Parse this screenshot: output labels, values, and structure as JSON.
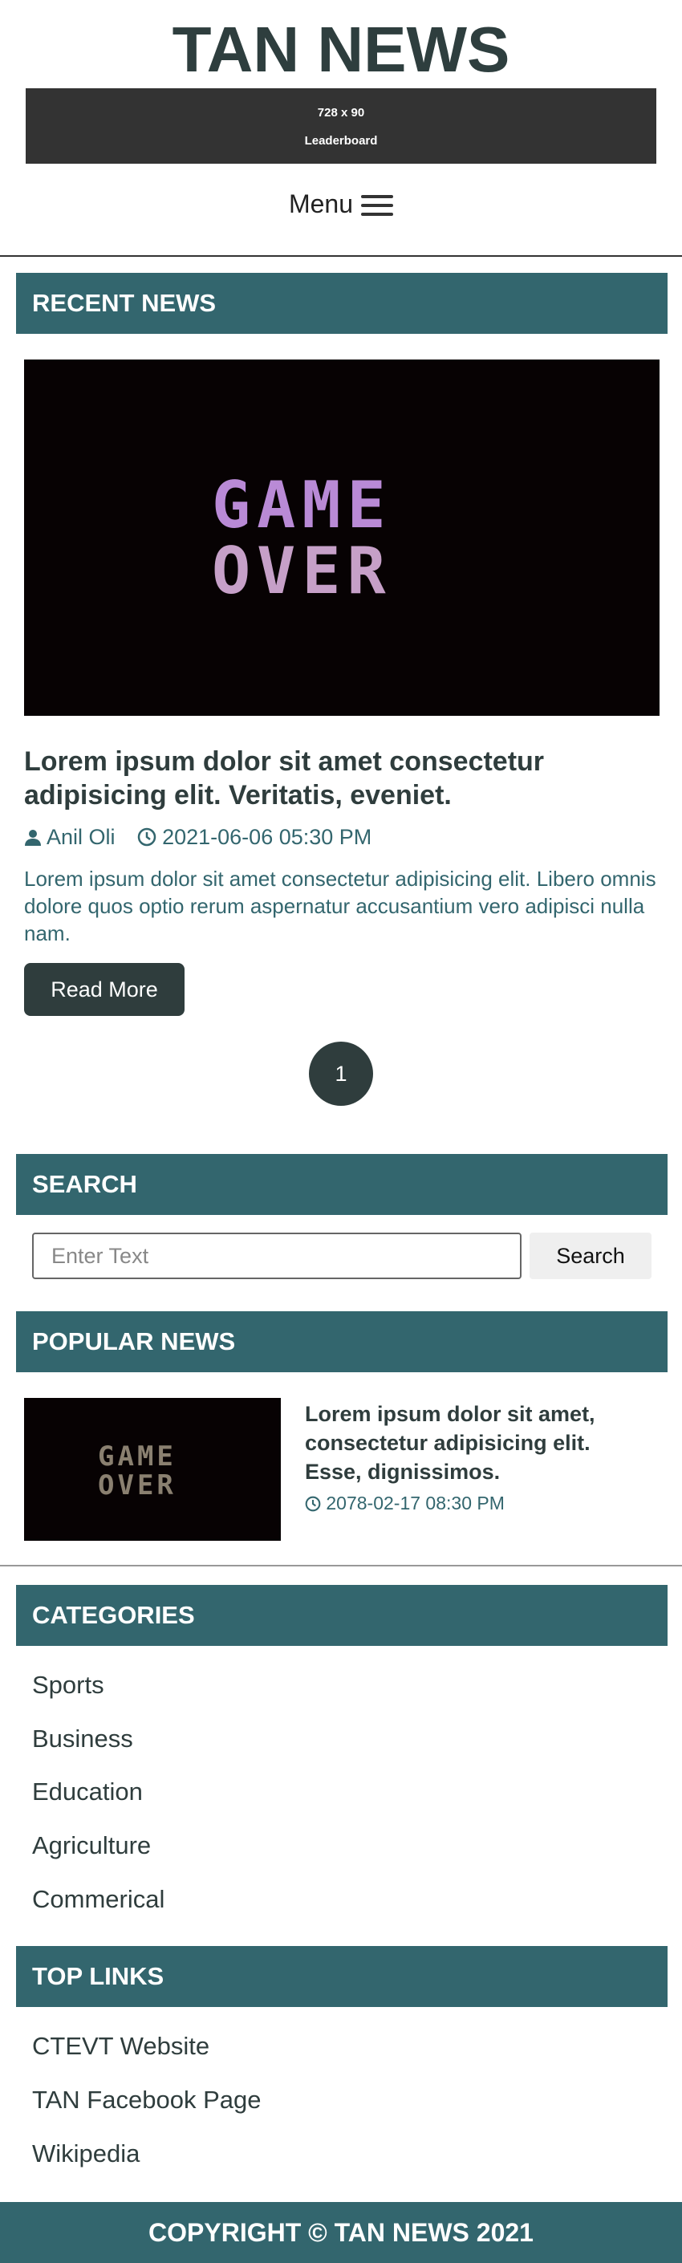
{
  "site": {
    "title": "TAN NEWS"
  },
  "ad": {
    "size": "728 x 90",
    "label": "Leaderboard"
  },
  "nav": {
    "menu_label": "Menu",
    "menu_icon": "hamburger-icon"
  },
  "recent_news": {
    "heading": "RECENT NEWS",
    "article": {
      "image_text": [
        "GAME",
        "OVER"
      ],
      "title": "Lorem ipsum dolor sit amet consectetur adipisicing elit. Veritatis, eveniet.",
      "author": "Anil Oli",
      "datetime": "2021-06-06 05:30 PM",
      "excerpt": "Lorem ipsum dolor sit amet consectetur adipisicing elit. Libero omnis dolore quos optio rerum aspernatur accusantium vero adipisci nulla nam.",
      "read_more": "Read More"
    },
    "pagination": {
      "current": "1"
    }
  },
  "search": {
    "heading": "SEARCH",
    "placeholder": "Enter Text",
    "button": "Search"
  },
  "popular_news": {
    "heading": "POPULAR NEWS",
    "item": {
      "image_text": [
        "GAME",
        "OVER"
      ],
      "title": "Lorem ipsum dolor sit amet, consectetur adipisicing elit. Esse, dignissimos.",
      "datetime": "2078-02-17 08:30 PM"
    }
  },
  "categories": {
    "heading": "CATEGORIES",
    "items": [
      "Sports",
      "Business",
      "Education",
      "Agriculture",
      "Commerical"
    ]
  },
  "top_links": {
    "heading": "TOP LINKS",
    "items": [
      "CTEVT Website",
      "TAN Facebook Page",
      "Wikipedia"
    ]
  },
  "footer": {
    "text": "COPYRIGHT © TAN NEWS 2021"
  },
  "colors": {
    "accent": "#33666e",
    "dark": "#2f3d3d",
    "footer": "#33666e"
  }
}
